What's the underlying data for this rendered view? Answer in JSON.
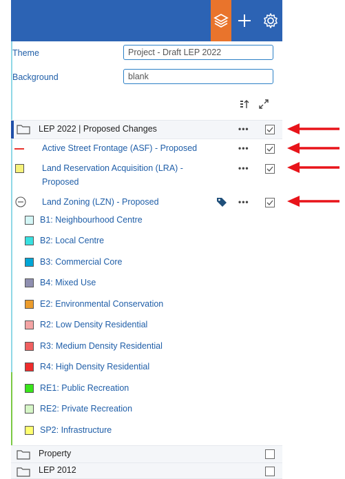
{
  "form": {
    "theme_label": "Theme",
    "theme_value": "Project - Draft LEP 2022",
    "background_label": "Background",
    "background_value": "blank"
  },
  "groups": {
    "lep2022": "LEP 2022 | Proposed Changes",
    "property": "Property",
    "lep2012": "LEP 2012"
  },
  "layers": {
    "asf": "Active Street Frontage (ASF) - Proposed",
    "lra_line1": "Land Reservation Acquisition (LRA) -",
    "lra_line2": "Proposed",
    "lzn": "Land Zoning (LZN) - Proposed"
  },
  "more_label": "•••",
  "legend": [
    {
      "label": "B1: Neighbourhood Centre",
      "color": "#d4f6f6"
    },
    {
      "label": "B2: Local Centre",
      "color": "#38e0e0"
    },
    {
      "label": "B3: Commercial Core",
      "color": "#00a6d6"
    },
    {
      "label": "B4: Mixed Use",
      "color": "#8f8fb0"
    },
    {
      "label": "E2: Environmental Conservation",
      "color": "#ec9c2c"
    },
    {
      "label": "R2: Low Density Residential",
      "color": "#f4a4a4"
    },
    {
      "label": "R3: Medium Density Residential",
      "color": "#f06060"
    },
    {
      "label": "R4: High Density Residential",
      "color": "#ee2c2c"
    },
    {
      "label": "RE1: Public Recreation",
      "color": "#39e51a"
    },
    {
      "label": "RE2: Private Recreation",
      "color": "#d6f6c6"
    },
    {
      "label": "SP2: Infrastructure",
      "color": "#ffff70"
    }
  ],
  "colors": {
    "topbar": "#2c63b4",
    "layers_button": "#e9742c",
    "link_text": "#1f5ea8",
    "asf_line": "#e8322c",
    "lra_swatch": "#f6f27a",
    "arrow": "#e8141a"
  },
  "icons": {
    "layers": "layers-icon",
    "plus": "plus-icon",
    "gear": "gear-icon",
    "sort": "sort-icon",
    "expand": "expand-icon",
    "folder": "folder-icon",
    "collapse": "minus-circle-icon",
    "tag": "tag-icon",
    "checkbox": "checkbox-checked-icon",
    "arrow": "red-arrow-icon"
  }
}
